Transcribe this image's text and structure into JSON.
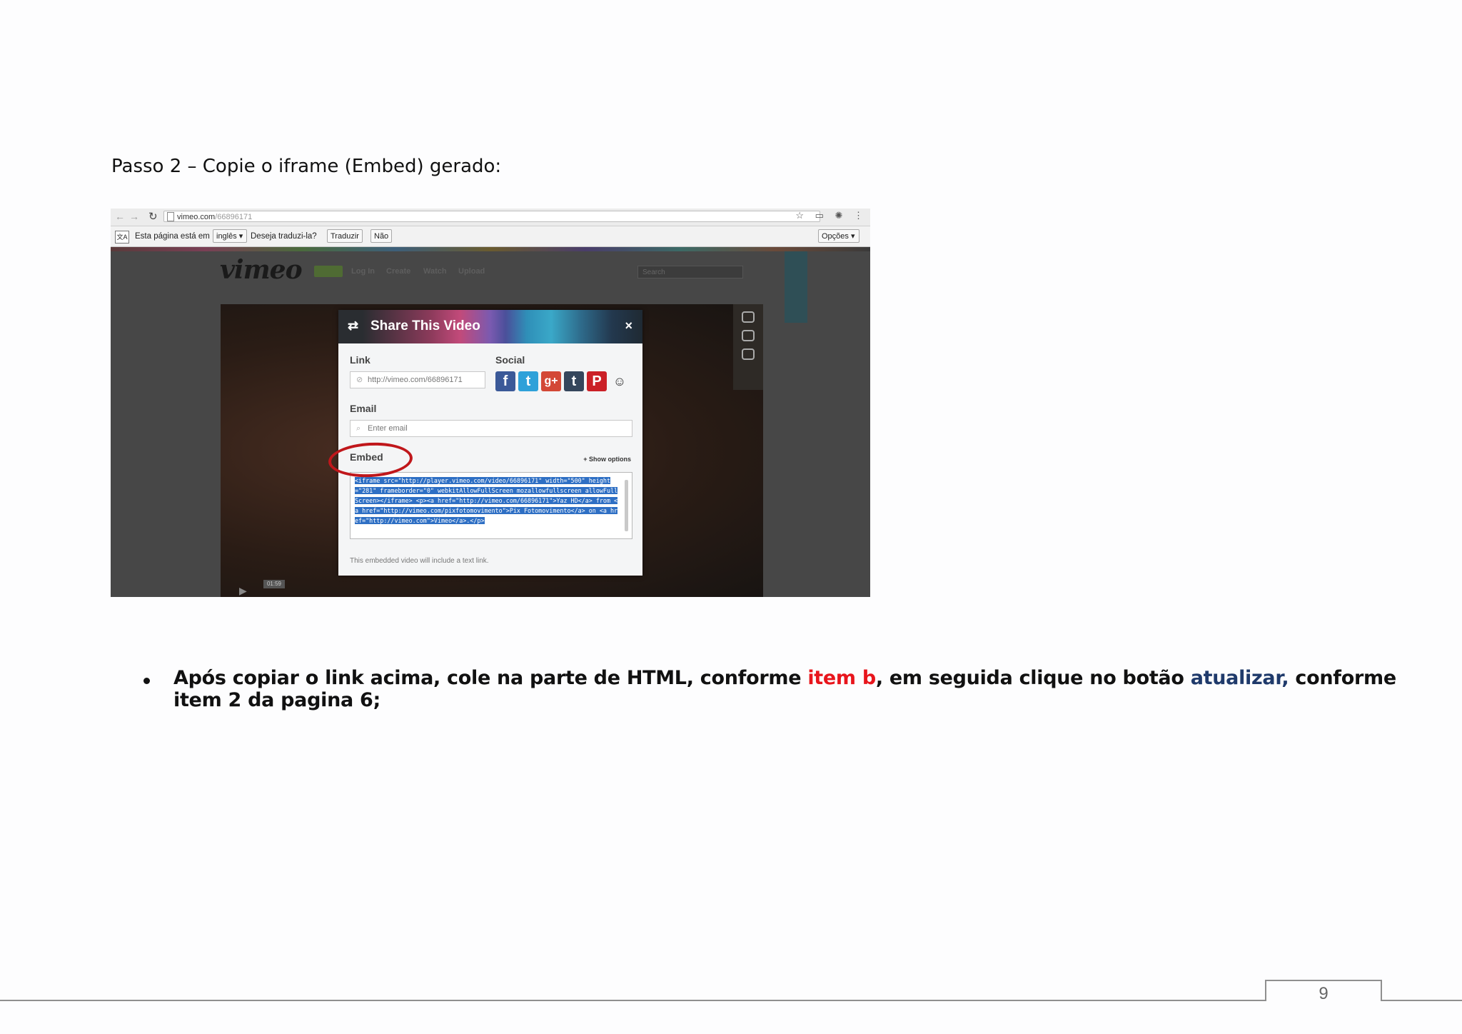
{
  "heading": "Passo 2 – Copie o iframe (Embed) gerado:",
  "browser": {
    "url_host": "vimeo.com",
    "url_path": "/66896171",
    "translate_bar": {
      "prefix": "Esta página está em",
      "language": "inglês",
      "question": "Deseja traduzi-la?",
      "translate_button": "Traduzir",
      "no_button": "Não",
      "options_button": "Opções"
    }
  },
  "vimeo": {
    "logo": "vimeo",
    "nav": [
      "Log In",
      "Create",
      "Watch",
      "Upload"
    ],
    "search_placeholder": "Search",
    "timecode": "01:59"
  },
  "share_modal": {
    "title": "Share This Video",
    "close": "×",
    "link_label": "Link",
    "link_value": "http://vimeo.com/66896171",
    "social_label": "Social",
    "social_icons": [
      "facebook-icon",
      "twitter-icon",
      "google-plus-icon",
      "tumblr-icon",
      "pinterest-icon",
      "reddit-icon"
    ],
    "email_label": "Email",
    "email_placeholder": "Enter email",
    "embed_label": "Embed",
    "show_options": "+ Show options",
    "embed_code": "<iframe src=\"http://player.vimeo.com/video/66896171\" width=\"500\" height=\"281\" frameborder=\"0\" webkitAllowFullScreen mozallowfullscreen allowFullScreen></iframe> <p><a href=\"http://vimeo.com/66896171\">Yaz HD</a> from <a href=\"http://vimeo.com/pixfotomovimento\">Pix Fotomovimento</a> on <a href=\"http://vimeo.com\">Vimeo</a>.</p>",
    "note": "This embedded video will include a text link."
  },
  "bullet": {
    "part1": "Após copiar o link acima, cole na parte de HTML, conforme ",
    "red": "item b",
    "part2": ", em seguida clique no botão ",
    "blue": "atualizar,",
    "part3": " conforme item 2 da pagina 6;"
  },
  "footer": {
    "page_number": "9"
  },
  "colors": {
    "highlight_red": "#e8151c",
    "highlight_blue": "#1f3a6b",
    "ring": "#c0171b"
  }
}
